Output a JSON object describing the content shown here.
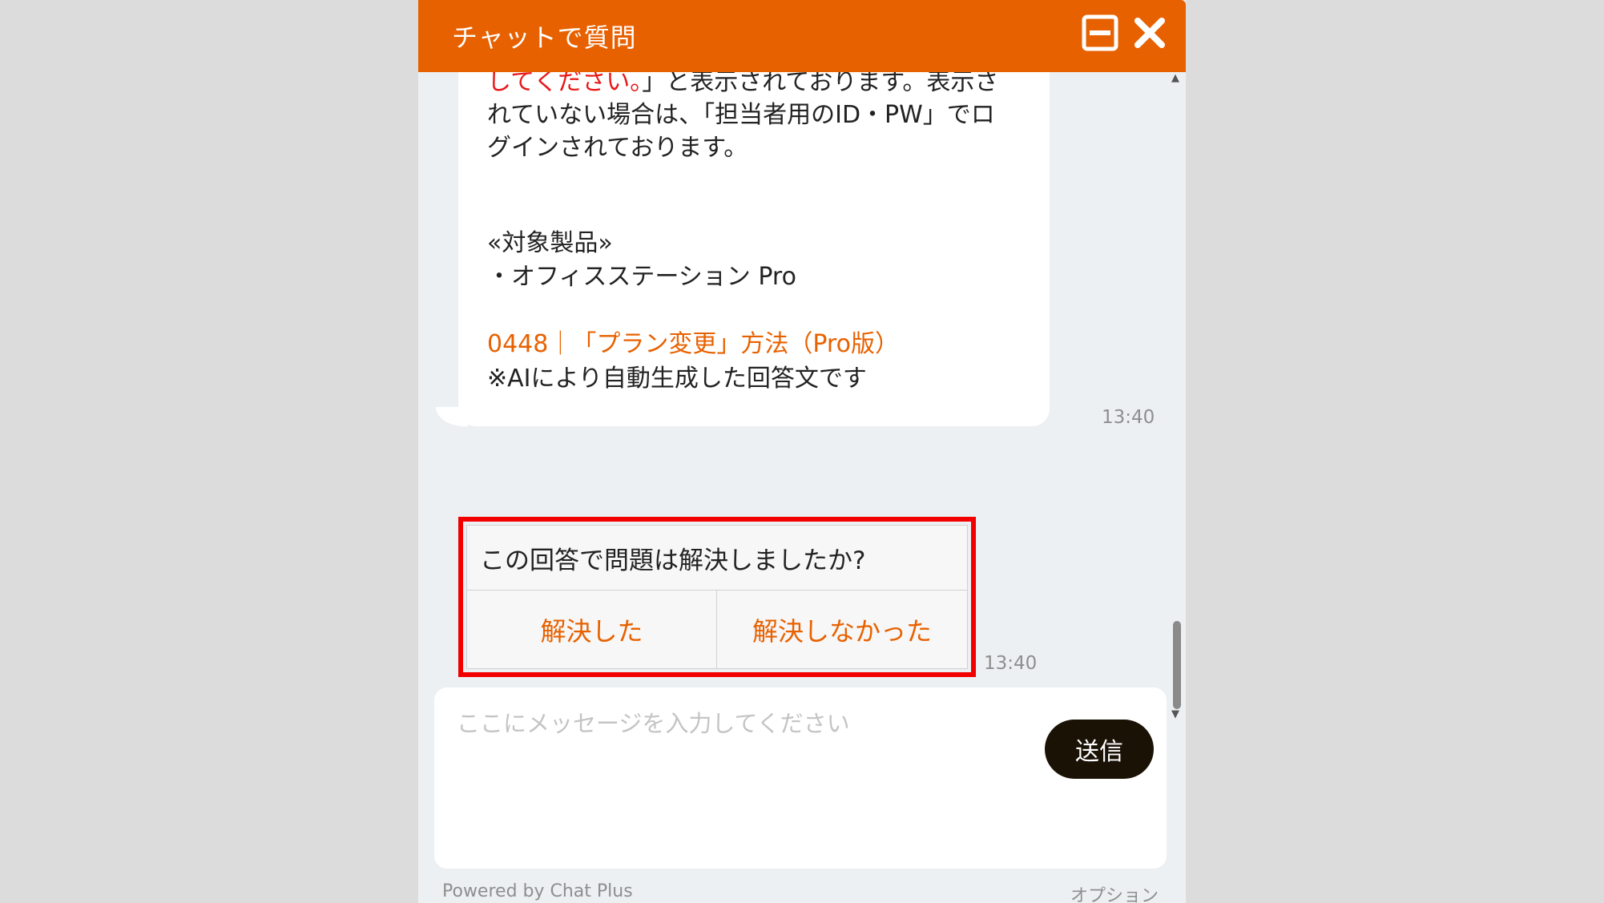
{
  "header": {
    "title": "チャットで質問"
  },
  "bot_message": {
    "line1_red": "してください。",
    "line1_rest": "」と表示されております。表示さ",
    "line2": "れていない場合は、「担当者用のID・PW」でロ",
    "line3": "グインされております。",
    "product_heading": "«対象製品»",
    "product_item": "・オフィスステーション Pro",
    "link_text": "0448｜「プラン変更」方法（Pro版）",
    "disclaimer": "※AIにより自動生成した回答文です",
    "timestamp": "13:40"
  },
  "survey": {
    "question": "この回答で問題は解決しましたか?",
    "yes_label": "解決した",
    "no_label": "解決しなかった",
    "timestamp": "13:40",
    "highlight_color": "#f20000"
  },
  "input": {
    "placeholder": "ここにメッセージを入力してください",
    "value": "",
    "send_label": "送信"
  },
  "footer": {
    "powered_by": "Powered by Chat Plus",
    "options": "オプション"
  },
  "colors": {
    "brand": "#e86100",
    "send_button": "#1b1206",
    "background": "#edf0f3"
  }
}
